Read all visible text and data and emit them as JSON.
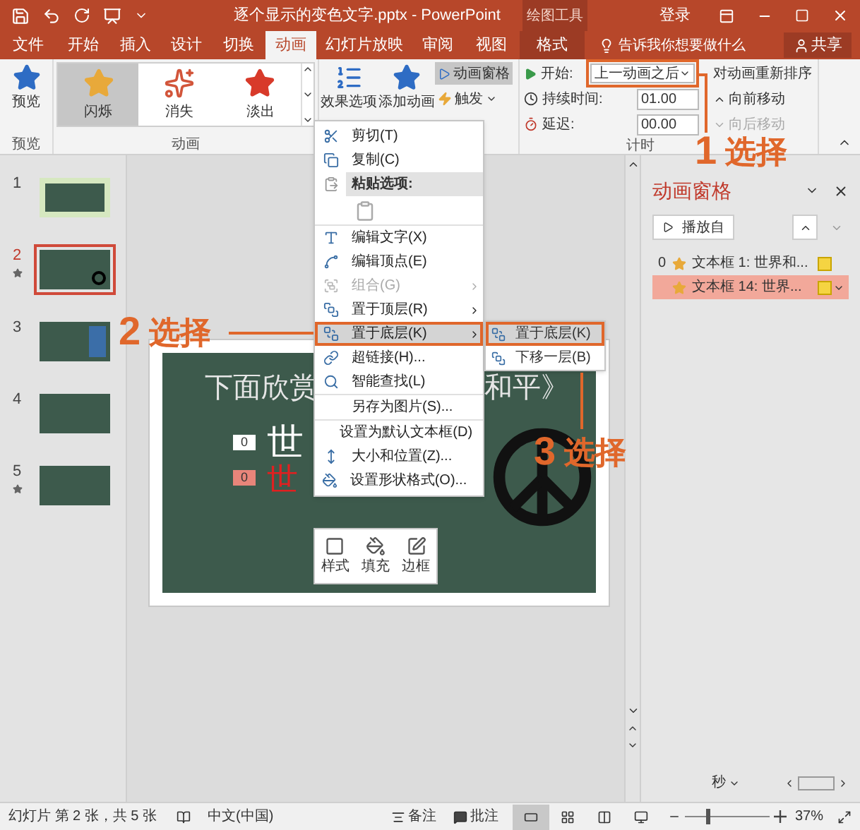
{
  "title_bar": {
    "title": "逐个显示的变色文字.pptx - PowerPoint",
    "context_group": "绘图工具",
    "sign_in": "登录"
  },
  "tabs": [
    {
      "label": "文件",
      "selected": false,
      "kind": "normal"
    },
    {
      "label": "开始",
      "selected": false,
      "kind": "normal"
    },
    {
      "label": "插入",
      "selected": false,
      "kind": "normal"
    },
    {
      "label": "设计",
      "selected": false,
      "kind": "normal"
    },
    {
      "label": "切换",
      "selected": false,
      "kind": "normal"
    },
    {
      "label": "动画",
      "selected": true,
      "kind": "normal"
    },
    {
      "label": "幻灯片放映",
      "selected": false,
      "kind": "normal"
    },
    {
      "label": "审阅",
      "selected": false,
      "kind": "normal"
    },
    {
      "label": "视图",
      "selected": false,
      "kind": "normal"
    },
    {
      "label": "格式",
      "selected": false,
      "kind": "context"
    }
  ],
  "tell_me": "告诉我你想要做什么",
  "share": "共享",
  "ribbon": {
    "preview": {
      "label": "预览",
      "group": "预览"
    },
    "gallery": {
      "group": "动画",
      "items": [
        {
          "label": "闪烁",
          "selected": true,
          "kind": "star-gold"
        },
        {
          "label": "消失",
          "selected": false,
          "kind": "burst"
        },
        {
          "label": "淡出",
          "selected": false,
          "kind": "star-red"
        }
      ]
    },
    "effect_options": "效果选项",
    "add_animation": "添加动画",
    "animation_pane_button": {
      "label": "动画窗格",
      "selected": true
    },
    "trigger": "触发",
    "timing": {
      "group": "计时",
      "start_label": "开始:",
      "start_value": "上一动画之后",
      "duration_label": "持续时间:",
      "duration_value": "01.00",
      "delay_label": "延迟:",
      "delay_value": "00.00",
      "reorder_title": "对动画重新排序",
      "move_earlier": {
        "label": "向前移动",
        "disabled": false
      },
      "move_later": {
        "label": "向后移动",
        "disabled": true
      }
    }
  },
  "thumbnails": [
    {
      "number": "1",
      "selected": false,
      "has_animation": false,
      "kind": "title"
    },
    {
      "number": "2",
      "selected": true,
      "has_animation": true,
      "kind": "peace"
    },
    {
      "number": "3",
      "selected": false,
      "has_animation": false,
      "kind": "image"
    },
    {
      "number": "4",
      "selected": false,
      "has_animation": false,
      "kind": "text"
    },
    {
      "number": "5",
      "selected": false,
      "has_animation": true,
      "kind": "blank"
    }
  ],
  "slide": {
    "title_left": "下面欣赏",
    "title_right": "和平》",
    "badges": [
      {
        "label": "0",
        "selected": false
      },
      {
        "label": "0",
        "selected": true
      }
    ],
    "line_1": "世",
    "line_2": "世"
  },
  "context_menu": [
    {
      "kind": "item",
      "label": "剪切(T)",
      "disabled": false,
      "submenu": false,
      "selected": false,
      "divider_above": false
    },
    {
      "kind": "item",
      "label": "复制(C)",
      "disabled": false,
      "submenu": false,
      "selected": false,
      "divider_above": false
    },
    {
      "kind": "header",
      "label": "粘贴选项:"
    },
    {
      "kind": "paste-icon"
    },
    {
      "kind": "item",
      "label": "编辑文字(X)",
      "disabled": false,
      "submenu": false,
      "selected": false,
      "divider_above": true
    },
    {
      "kind": "item",
      "label": "编辑顶点(E)",
      "disabled": false,
      "submenu": false,
      "selected": false,
      "divider_above": false
    },
    {
      "kind": "item",
      "label": "组合(G)",
      "disabled": true,
      "submenu": true,
      "selected": false,
      "divider_above": false
    },
    {
      "kind": "item",
      "label": "置于顶层(R)",
      "disabled": false,
      "submenu": true,
      "selected": false,
      "divider_above": false
    },
    {
      "kind": "item",
      "label": "置于底层(K)",
      "disabled": false,
      "submenu": true,
      "selected": true,
      "divider_above": false
    },
    {
      "kind": "item",
      "label": "超链接(H)...",
      "disabled": false,
      "submenu": false,
      "selected": false,
      "divider_above": false
    },
    {
      "kind": "item",
      "label": "智能查找(L)",
      "disabled": false,
      "submenu": false,
      "selected": false,
      "divider_above": false
    },
    {
      "kind": "item",
      "label": "另存为图片(S)...",
      "disabled": false,
      "submenu": false,
      "selected": false,
      "divider_above": true
    },
    {
      "kind": "item",
      "label": "设置为默认文本框(D)",
      "disabled": false,
      "submenu": false,
      "selected": false,
      "divider_above": true
    },
    {
      "kind": "item",
      "label": "大小和位置(Z)...",
      "disabled": false,
      "submenu": false,
      "selected": false,
      "divider_above": false
    },
    {
      "kind": "item",
      "label": "设置形状格式(O)...",
      "disabled": false,
      "submenu": false,
      "selected": false,
      "divider_above": false
    }
  ],
  "submenu": [
    {
      "label": "置于底层(K)",
      "selected": true
    },
    {
      "label": "下移一层(B)",
      "selected": false
    }
  ],
  "mini_toolbar": [
    "样式",
    "填充",
    "边框"
  ],
  "annotations": [
    {
      "number": "1",
      "label": "选择"
    },
    {
      "number": "2",
      "label": "选择"
    },
    {
      "number": "3",
      "label": "选择"
    }
  ],
  "animation_pane": {
    "title": "动画窗格",
    "play_from": "播放自",
    "items": [
      {
        "index": "0",
        "label": "文本框 1: 世界和...",
        "selected": false
      },
      {
        "label": "文本框 14: 世界...",
        "selected": true
      }
    ],
    "time_unit": "秒"
  },
  "status_bar": {
    "slide_info": "幻灯片 第 2 张，共 5 张",
    "language": "中文(中国)",
    "notes": "备注",
    "comments": "批注",
    "zoom": "37%",
    "zoom_slider": {
      "level": 0.25
    }
  }
}
